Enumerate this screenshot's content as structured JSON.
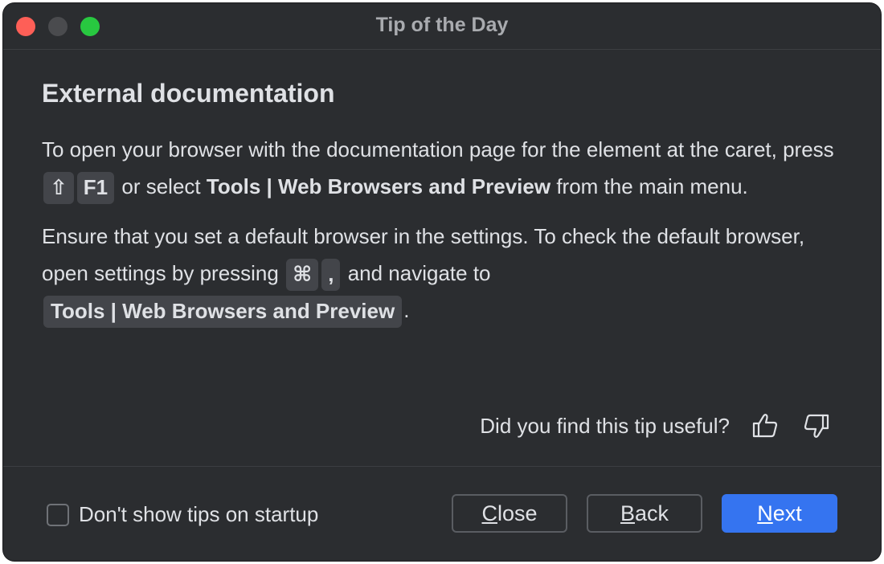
{
  "window": {
    "title": "Tip of the Day"
  },
  "tip": {
    "heading": "External documentation",
    "para1": {
      "text_a": "To open your browser with the documentation page for the element at the caret, press",
      "key_shift": "⇧",
      "key_f1": "F1",
      "text_b": "or select",
      "menu_path": "Tools | Web Browsers and Preview",
      "text_c": "from the main menu."
    },
    "para2": {
      "text_a": "Ensure that you set a default browser in the settings. To check the default browser, open settings by pressing",
      "key_cmd": "⌘",
      "key_comma": ",",
      "text_b": "and navigate to",
      "menu_path": "Tools | Web Browsers and Preview",
      "text_c": "."
    }
  },
  "feedback": {
    "question": "Did you find this tip useful?"
  },
  "footer": {
    "checkbox_label": "Don't show tips on startup",
    "close": {
      "mnemonic": "C",
      "rest": "lose"
    },
    "back": {
      "mnemonic": "B",
      "rest": "ack"
    },
    "next": {
      "mnemonic": "N",
      "rest": "ext"
    }
  },
  "colors": {
    "accent": "#3574f0",
    "background": "#2b2d30",
    "text": "#dfe1e5"
  }
}
